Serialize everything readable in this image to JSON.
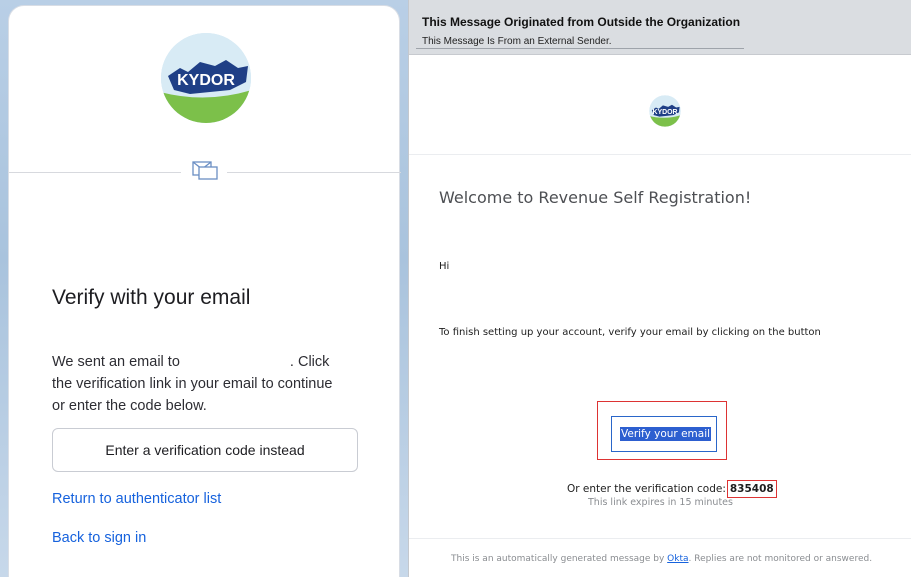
{
  "left": {
    "logo_text": "KYDOR",
    "title": "Verify with your email",
    "desc_before": "We sent an email to",
    "desc_after_1": ". Click",
    "desc_line2": "the verification link in your email to continue",
    "desc_line3": "or enter the code below.",
    "code_button_label": "Enter a verification code instead",
    "return_link": "Return to authenticator list",
    "back_link": "Back to sign in"
  },
  "email": {
    "banner_title": "This Message Originated from Outside the Organization",
    "banner_sub": "This Message Is From an External Sender.",
    "logo_text": "KYDOR",
    "welcome": "Welcome to Revenue Self Registration!",
    "greeting": "Hi",
    "instruction": "To finish setting up your account, verify your email by clicking on the button",
    "verify_button_label": "Verify your email",
    "code_prefix": "Or enter the verification code:",
    "code_value": "835408",
    "expires": "This link expires in 15 minutes",
    "footer_before": "This is an automatically generated message by",
    "footer_link": "Okta",
    "footer_after": ". Replies are not monitored or answered."
  },
  "colors": {
    "link": "#1662dd",
    "highlight_box": "#dd3333",
    "button_highlight": "#2d5fd0",
    "logo_blue": "#1f3f86",
    "logo_green": "#7cc04a"
  },
  "icons": {
    "card_divider": "envelope-icon",
    "left_logo": "kydor-logo",
    "email_logo": "kydor-logo"
  }
}
